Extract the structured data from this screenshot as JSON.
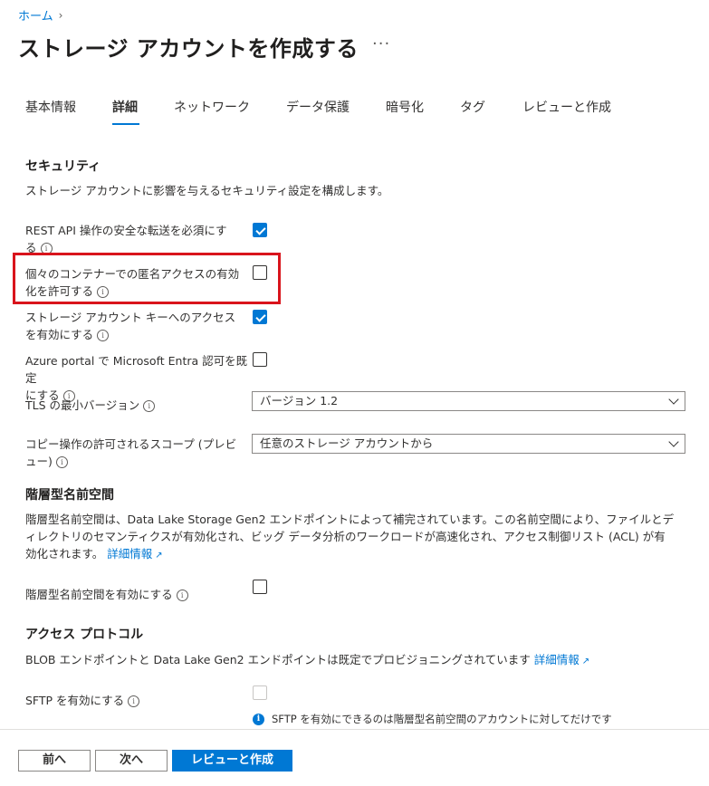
{
  "breadcrumb": {
    "home": "ホーム",
    "separator": "›"
  },
  "page": {
    "title": "ストレージ アカウントを作成する",
    "more": "···"
  },
  "tabs": [
    {
      "label": "基本情報"
    },
    {
      "label": "詳細"
    },
    {
      "label": "ネットワーク"
    },
    {
      "label": "データ保護"
    },
    {
      "label": "暗号化"
    },
    {
      "label": "タグ"
    },
    {
      "label": "レビューと作成"
    }
  ],
  "security": {
    "heading": "セキュリティ",
    "description": "ストレージ アカウントに影響を与えるセキュリティ設定を構成します。",
    "secure_transfer": {
      "label_line1": "REST API 操作の安全な転送を必須にす",
      "label_line2": "る",
      "checked": true
    },
    "anonymous_access": {
      "label_line1": "個々のコンテナーでの匿名アクセスの有効",
      "label_line2": "化を許可する",
      "checked": false
    },
    "account_key": {
      "label_line1": "ストレージ アカウント キーへのアクセス",
      "label_line2": "を有効にする",
      "checked": true
    },
    "entra_default": {
      "label_line1": "Azure portal で Microsoft Entra 認可を既定",
      "label_line2": "にする",
      "checked": false
    },
    "tls": {
      "label": "TLS の最小バージョン",
      "value": "バージョン 1.2"
    },
    "copy_scope": {
      "label_line1": "コピー操作の許可されるスコープ (プレビ",
      "label_line2": "ュー)",
      "value": "任意のストレージ アカウントから"
    }
  },
  "hns": {
    "heading": "階層型名前空間",
    "desc_line1": "階層型名前空間は、Data Lake Storage Gen2 エンドポイントによって補完されています。この名前空間により、ファイルとデ",
    "desc_line2": "ィレクトリのセマンティクスが有効化され、ビッグ データ分析のワークロードが高速化され、アクセス制御リスト (ACL) が有",
    "desc_line3": "効化されます。",
    "learn_more": "詳細情報",
    "enable_label": "階層型名前空間を有効にする",
    "checked": false
  },
  "protocol": {
    "heading": "アクセス プロトコル",
    "description": "BLOB エンドポイントと Data Lake Gen2 エンドポイントは既定でプロビジョニングされています",
    "learn_more": "詳細情報",
    "sftp_label": "SFTP を有効にする",
    "sftp_checked": false,
    "sftp_note": "SFTP を有効にできるのは階層型名前空間のアカウントに対してだけです"
  },
  "footer": {
    "prev": "前へ",
    "next": "次へ",
    "review": "レビューと作成"
  },
  "colors": {
    "accent": "#0078d4",
    "highlight": "#d9141c"
  }
}
